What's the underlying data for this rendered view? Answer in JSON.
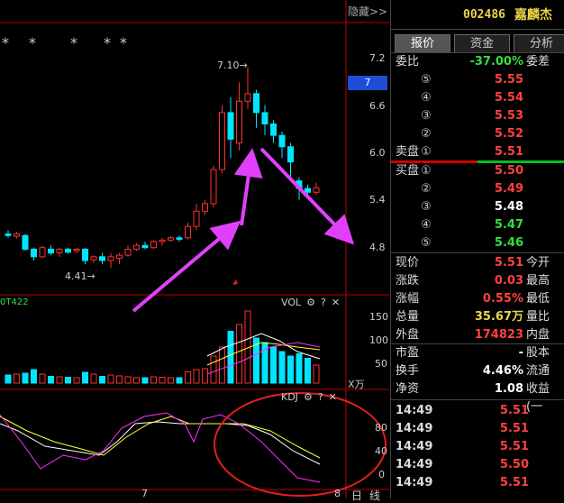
{
  "chart": {
    "hide_label": "隐藏>>",
    "asterisks": [
      "*",
      "*",
      "*",
      "*",
      "*"
    ],
    "price_ticks": [
      "7.2",
      "6.6",
      "6.0",
      "5.4",
      "4.8"
    ],
    "current_price_tag": "7",
    "high_label": "7.10",
    "low_label": "4.41",
    "indicator_code": "0T422",
    "vol_label": "VOL",
    "vol_ticks": [
      "150",
      "100",
      "50"
    ],
    "vol_unit": "X万",
    "kdj_label": "KDJ",
    "kdj_ticks": [
      "80",
      "40",
      "0"
    ],
    "bottom_date": "7",
    "bottom_buttons": [
      "日",
      "线"
    ],
    "bottom_tick": "8",
    "gear_icon": "gear-icon",
    "help_label": "?",
    "close_label": "✕",
    "colors": {
      "up": "#ff3030",
      "down": "#00e5ff",
      "k": "#ffffff",
      "d": "#ffff30",
      "j": "#ff30ff",
      "arrow": "#e040fb"
    }
  },
  "panel": {
    "code": "002486",
    "name": "嘉麟杰",
    "tabs": [
      "报价",
      "资金",
      "分析"
    ],
    "weibi": {
      "label": "委比",
      "value": "-37.00%",
      "right": "委差"
    },
    "sell": [
      {
        "idx": "⑤",
        "price": "5.55"
      },
      {
        "idx": "④",
        "price": "5.54"
      },
      {
        "idx": "③",
        "price": "5.53"
      },
      {
        "idx": "②",
        "price": "5.52"
      },
      {
        "idx": "①",
        "price": "5.51",
        "prefix": "卖盘"
      }
    ],
    "buy": [
      {
        "idx": "①",
        "price": "5.50",
        "prefix": "买盘",
        "color": "red"
      },
      {
        "idx": "②",
        "price": "5.49",
        "color": "red"
      },
      {
        "idx": "③",
        "price": "5.48",
        "color": "white"
      },
      {
        "idx": "④",
        "price": "5.47",
        "color": "green"
      },
      {
        "idx": "⑤",
        "price": "5.46",
        "color": "green"
      }
    ],
    "stats": [
      {
        "label": "现价",
        "value": "5.51",
        "right": "今开",
        "color": "red"
      },
      {
        "label": "涨跌",
        "value": "0.03",
        "right": "最高",
        "color": "red"
      },
      {
        "label": "涨幅",
        "value": "0.55%",
        "right": "最低",
        "color": "red"
      },
      {
        "label": "总量",
        "value": "35.67万",
        "right": "量比",
        "color": "yellow"
      },
      {
        "label": "外盘",
        "value": "174823",
        "right": "内盘",
        "color": "red"
      }
    ],
    "fundamentals": [
      {
        "label": "市盈",
        "value": "-",
        "right": "股本"
      },
      {
        "label": "换手",
        "value": "4.46%",
        "right": "流通"
      },
      {
        "label": "净资",
        "value": "1.08",
        "right": "收益(一"
      }
    ],
    "ticks": [
      {
        "time": "14:49",
        "price": "5.51"
      },
      {
        "time": "14:49",
        "price": "5.51"
      },
      {
        "time": "14:49",
        "price": "5.51"
      },
      {
        "time": "14:49",
        "price": "5.50"
      },
      {
        "time": "14:49",
        "price": "5.51"
      }
    ]
  }
}
